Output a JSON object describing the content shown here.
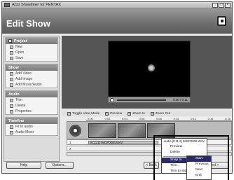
{
  "window": {
    "title": "ACD Showtime! for PENTAX",
    "controls": [
      "_",
      "□",
      "×"
    ]
  },
  "header": {
    "title": "Edit Show"
  },
  "sidebar": {
    "groups": [
      {
        "title": "Project",
        "items": [
          "New",
          "Open",
          "Save"
        ]
      },
      {
        "title": "Show",
        "items": [
          "Add Video",
          "Add Image",
          "Add Music/Audio"
        ]
      },
      {
        "title": "Audio",
        "items": [
          "Trim",
          "Delete",
          "Properties"
        ]
      },
      {
        "title": "Timeline",
        "items": [
          "Fit to audio",
          "Audio Mixer"
        ]
      }
    ]
  },
  "player": {
    "timecode": "0:00 / 0:11"
  },
  "timeline_toolbar": {
    "toggle": "Toggle View Mode",
    "preview": "Preview",
    "zoom_in": "Zoom In",
    "zoom_out": "Zoom Out"
  },
  "ruler": [
    "0:00",
    "0:02",
    "0:04",
    "0:06",
    "0:08",
    "0:10",
    "0:12",
    "0:14",
    "0:16"
  ],
  "tracks": {
    "row1_label": "1",
    "row1_clip": "[0:11.2] IMGP0006.WAV",
    "row2_label": "2",
    "audio_tag": "audio [0:11.2] IMGP0006.WAV"
  },
  "context_menu": {
    "items": [
      "Preview",
      "Delete",
      "Snap to",
      "Trim...",
      "Trim to slide"
    ],
    "submenu": [
      "Start",
      "Previous",
      "Next",
      "End"
    ]
  },
  "footer": {
    "help": "Help",
    "options": "Options...",
    "back": "< Back",
    "next": "Next >"
  }
}
